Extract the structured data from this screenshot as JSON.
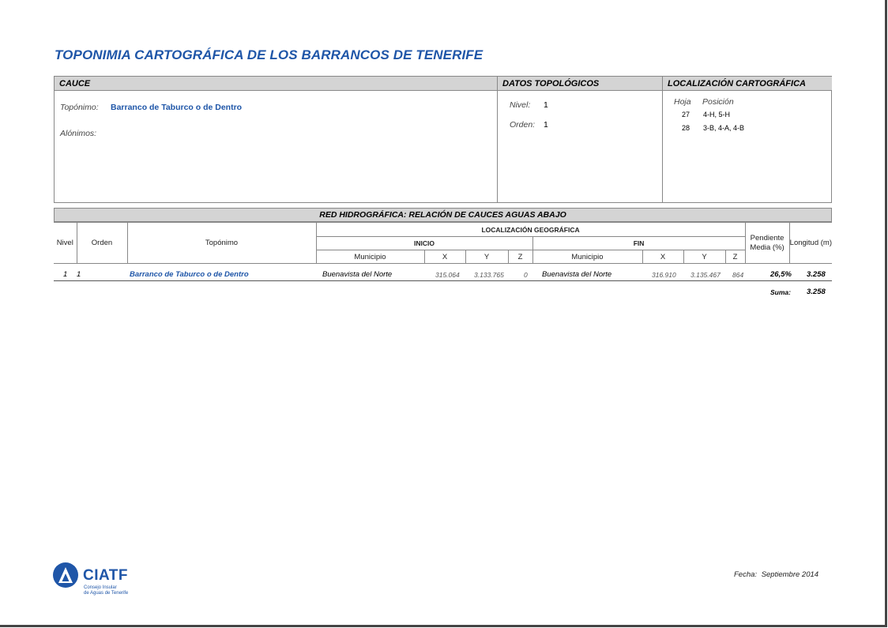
{
  "document": {
    "title": "TOPONIMIA CARTOGRÁFICA DE LOS BARRANCOS DE TENERIFE"
  },
  "cauce": {
    "header": "CAUCE",
    "toponimo_label": "Topónimo:",
    "toponimo_value": "Barranco de Taburco o de Dentro",
    "alonimos_label": "Alónimos:"
  },
  "datos_topologicos": {
    "header": "DATOS TOPOLÓGICOS",
    "nivel_label": "Nivel:",
    "nivel_value": "1",
    "orden_label": "Orden:",
    "orden_value": "1"
  },
  "localizacion": {
    "header": "LOCALIZACIÓN CARTOGRÁFICA",
    "hoja_label": "Hoja",
    "posicion_label": "Posición",
    "rows": [
      {
        "hoja": "27",
        "posicion": "4-H, 5-H"
      },
      {
        "hoja": "28",
        "posicion": "3-B, 4-A, 4-B"
      }
    ]
  },
  "red": {
    "header": "RED HIDROGRÁFICA: RELACIÓN DE CAUCES AGUAS ABAJO",
    "columns": {
      "nivel": "Nivel",
      "orden": "Orden",
      "toponimo": "Topónimo",
      "localizacion": "LOCALIZACIÓN GEOGRÁFICA",
      "inicio": "INICIO",
      "fin": "FIN",
      "municipio": "Municipio",
      "x": "X",
      "y": "Y",
      "z": "Z",
      "pendiente": "Pendiente Media (%)",
      "longitud": "Longitud (m)"
    },
    "rows": [
      {
        "nivel": "1",
        "orden": "1",
        "toponimo": "Barranco de Taburco o de Dentro",
        "inicio_municipio": "Buenavista del Norte",
        "inicio_x": "315.064",
        "inicio_y": "3.133.765",
        "inicio_z": "0",
        "fin_municipio": "Buenavista del Norte",
        "fin_x": "316.910",
        "fin_y": "3.135.467",
        "fin_z": "864",
        "pendiente": "26,5%",
        "longitud": "3.258"
      }
    ],
    "suma_label": "Suma:",
    "suma_value": "3.258"
  },
  "footer": {
    "logo_text": "CIATF",
    "logo_sub_1": "Consejo Insular",
    "logo_sub_2": "de Aguas de Tenerife",
    "fecha_label": "Fecha:",
    "fecha_value": "Septiembre 2014",
    "brand_color": "#1f56a8"
  }
}
